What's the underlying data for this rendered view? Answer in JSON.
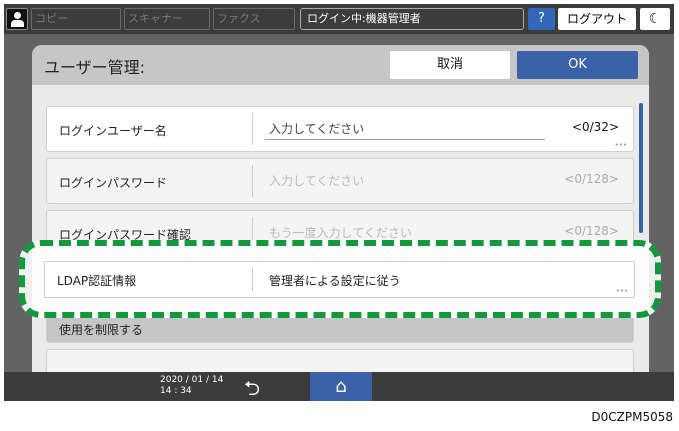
{
  "topbar": {
    "tabs": [
      "コピー",
      "スキャナー",
      "ファクス"
    ],
    "login_status": "ログイン中:機器管理者",
    "help": "?",
    "logout": "ログアウト",
    "moon": "☾"
  },
  "dialog": {
    "title": "ユーザー管理:",
    "cancel": "取消",
    "ok": "OK",
    "rows": [
      {
        "label": "ログインユーザー名",
        "placeholder": "入力してください",
        "count": "<0/32>"
      },
      {
        "label": "ログインパスワード",
        "placeholder": "入力してください",
        "count": "<0/128>"
      },
      {
        "label": "ログインパスワード確認",
        "placeholder": "もう一度入力してください",
        "count": "<0/128>"
      },
      {
        "label": "LDAP認証情報",
        "value": "管理者による設定に従う"
      }
    ],
    "section": "使用を制限する"
  },
  "bottombar": {
    "date": "2020 / 01 / 14",
    "time": "14 : 34"
  },
  "figure_code": "D0CZPM5058",
  "colors": {
    "accent": "#3a62a8",
    "highlight": "#119a3c"
  }
}
